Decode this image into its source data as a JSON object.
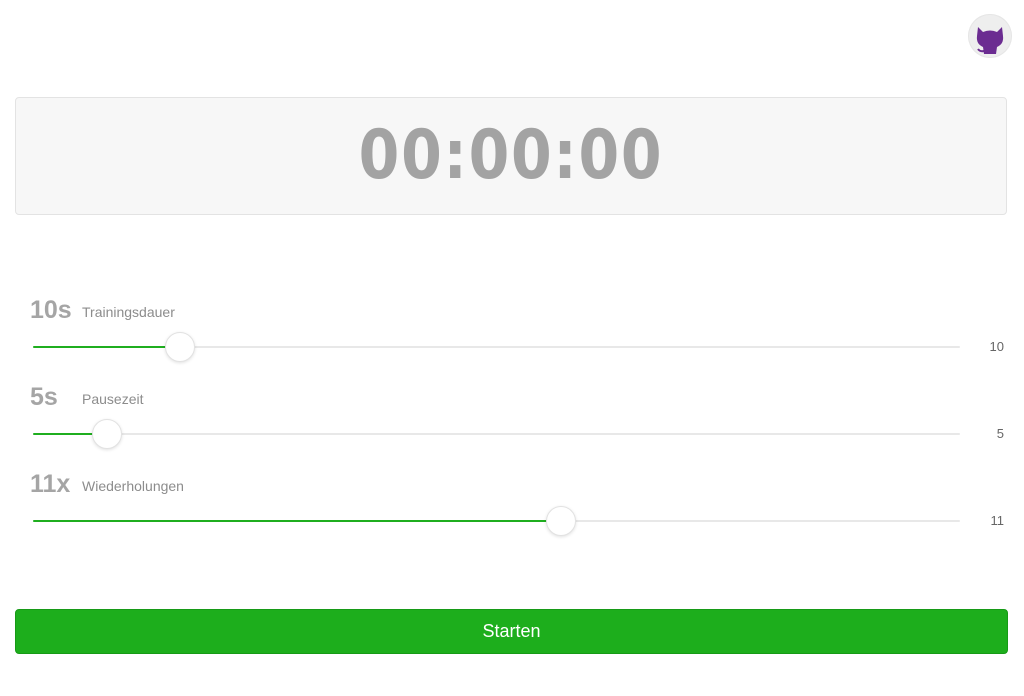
{
  "avatar": {
    "icon": "octocat-icon",
    "color": "#6b2c91"
  },
  "timer": {
    "display": "00:00:00"
  },
  "settings": [
    {
      "big_value": "10s",
      "label": "Trainingsdauer",
      "value": "10",
      "fill_fraction": 0.16
    },
    {
      "big_value": "5s",
      "label": "Pausezeit",
      "value": "5",
      "fill_fraction": 0.08
    },
    {
      "big_value": "11x",
      "label": "Wiederholungen",
      "value": "11",
      "fill_fraction": 0.57
    }
  ],
  "start_button": {
    "label": "Starten",
    "color": "#1dae1c"
  }
}
